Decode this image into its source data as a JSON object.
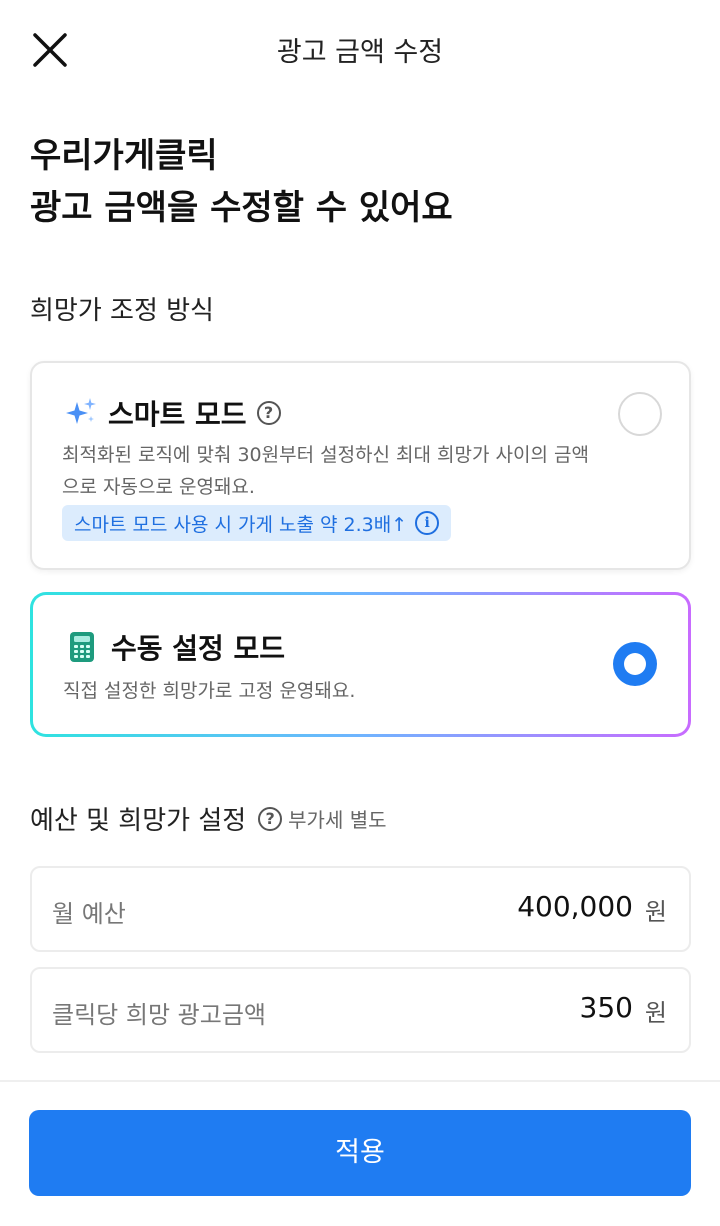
{
  "header": {
    "title": "광고 금액 수정",
    "close_icon": "close-icon"
  },
  "headline": {
    "line1": "우리가게클릭",
    "line2": "광고 금액을 수정할 수 있어요"
  },
  "adjust_section": {
    "label": "희망가 조정 방식"
  },
  "smart_mode": {
    "icon": "sparkles-icon",
    "title": "스마트 모드",
    "description_line1": "최적화된 로직에 맞춰 30원부터 설정하신 최대 희망가 사이의 금액",
    "description_line2": "으로 자동으로 운영돼요.",
    "badge": "스마트 모드 사용 시 가게 노출 약 2.3배↑",
    "selected": false
  },
  "manual_mode": {
    "icon": "calculator-icon",
    "title": "수동 설정 모드",
    "description": "직접 설정한 희망가로 고정 운영돼요.",
    "selected": true
  },
  "budget_section": {
    "label": "예산 및 희망가 설정",
    "vat_note": "부가세 별도"
  },
  "monthly_budget": {
    "label": "월 예산",
    "value": "400,000",
    "unit": "원"
  },
  "bid_per_click": {
    "label": "클릭당 희망 광고금액",
    "value": "350",
    "unit": "원"
  },
  "footer": {
    "apply_label": "적용"
  },
  "colors": {
    "primary": "#1f7cf2",
    "badge_bg": "#dcecfd",
    "badge_text": "#1f6fe0"
  }
}
